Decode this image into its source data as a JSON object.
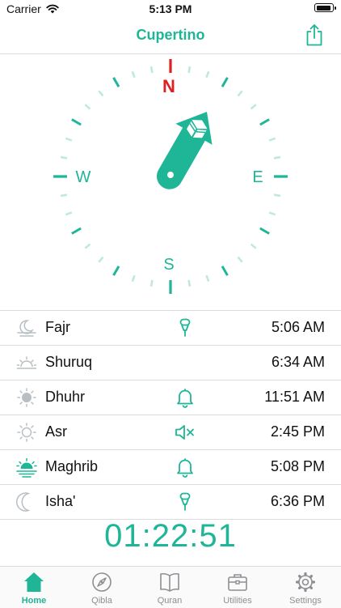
{
  "status_bar": {
    "carrier": "Carrier",
    "time": "5:13 PM",
    "battery_level": 0.95
  },
  "header": {
    "title": "Cupertino",
    "share_icon": "share-icon"
  },
  "compass": {
    "north": "N",
    "east": "E",
    "south": "S",
    "west": "W",
    "qibla_bearing_degrees": 30,
    "accent_color": "#1fb597",
    "north_color": "#e02020"
  },
  "prayers": [
    {
      "name": "Fajr",
      "time": "5:06 AM",
      "icon": "fajr-icon",
      "alert": "microphone-icon"
    },
    {
      "name": "Shuruq",
      "time": "6:34 AM",
      "icon": "sunrise-icon",
      "alert": ""
    },
    {
      "name": "Dhuhr",
      "time": "11:51 AM",
      "icon": "sun-icon",
      "alert": "bell-icon"
    },
    {
      "name": "Asr",
      "time": "2:45 PM",
      "icon": "sun-outline-icon",
      "alert": "speaker-muted-icon"
    },
    {
      "name": "Maghrib",
      "time": "5:08 PM",
      "icon": "sunset-icon",
      "alert": "bell-icon"
    },
    {
      "name": "Isha'",
      "time": "6:36 PM",
      "icon": "moon-icon",
      "alert": "microphone-icon"
    }
  ],
  "countdown": "01:22:51",
  "tabs": [
    {
      "label": "Home",
      "icon": "home-icon",
      "active": true
    },
    {
      "label": "Qibla",
      "icon": "compass-icon",
      "active": false
    },
    {
      "label": "Quran",
      "icon": "book-icon",
      "active": false
    },
    {
      "label": "Utilities",
      "icon": "briefcase-icon",
      "active": false
    },
    {
      "label": "Settings",
      "icon": "gear-icon",
      "active": false
    }
  ]
}
